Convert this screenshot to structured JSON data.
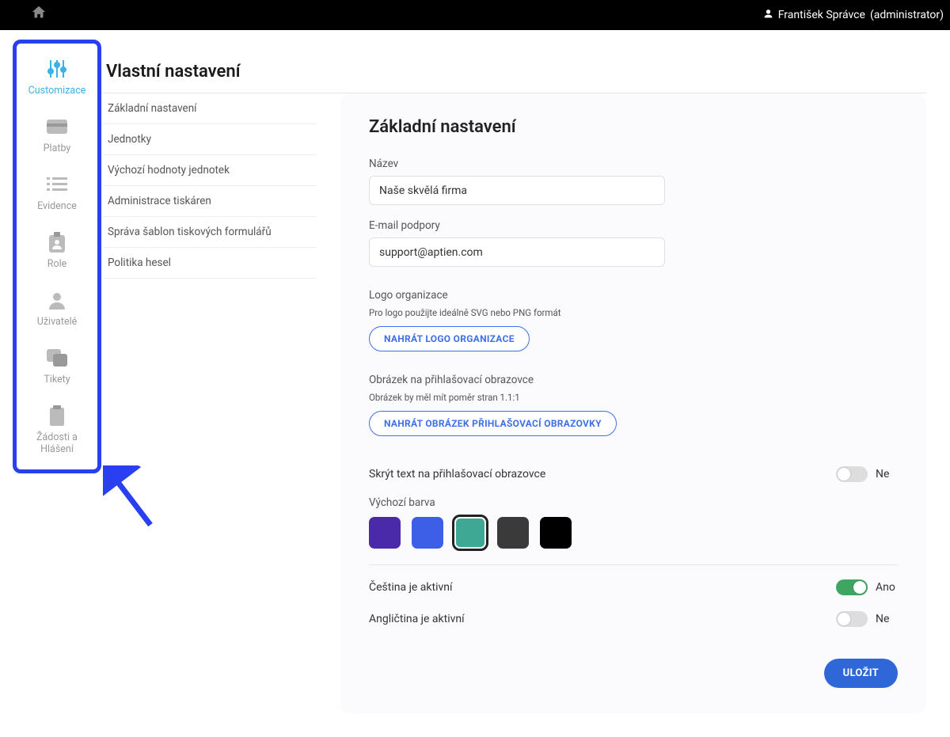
{
  "topbar": {
    "user_name": "František Správce",
    "user_role": "(administrator)"
  },
  "sidebar": {
    "items": [
      {
        "label": "Customizace",
        "icon": "sliders",
        "active": true
      },
      {
        "label": "Platby",
        "icon": "card",
        "active": false
      },
      {
        "label": "Evidence",
        "icon": "list",
        "active": false
      },
      {
        "label": "Role",
        "icon": "badge",
        "active": false
      },
      {
        "label": "Uživatelé",
        "icon": "user",
        "active": false
      },
      {
        "label": "Tikety",
        "icon": "tickets",
        "active": false
      },
      {
        "label": "Žádosti a Hlášení",
        "icon": "clipboard",
        "active": false
      }
    ]
  },
  "page": {
    "title": "Vlastní nastavení",
    "subnav": [
      "Základní nastavení",
      "Jednotky",
      "Výchozí hodnoty jednotek",
      "Administrace tiskáren",
      "Správa šablon tiskových formulářů",
      "Politika hesel"
    ]
  },
  "form": {
    "title": "Základní nastavení",
    "name_label": "Název",
    "name_value": "Naše skvělá firma",
    "email_label": "E-mail podpory",
    "email_value": "support@aptien.com",
    "logo_label": "Logo organizace",
    "logo_hint": "Pro logo použijte ideálně SVG nebo PNG formát",
    "logo_button": "NAHRÁT LOGO ORGANIZACE",
    "loginimg_label": "Obrázek na přihlašovací obrazovce",
    "loginimg_hint": "Obrázek by měl mít poměr stran 1.1:1",
    "loginimg_button": "NAHRÁT OBRÁZEK PŘIHLAŠOVACÍ OBRAZOVKY",
    "hide_text_label": "Skrýt text na přihlašovací obrazovce",
    "hide_text_value": "Ne",
    "color_label": "Výchozí barva",
    "colors": [
      "#4a2aa8",
      "#3d5fe8",
      "#3fa894",
      "#3a3a3a",
      "#000000"
    ],
    "color_selected_index": 2,
    "czech_label": "Čeština je aktivní",
    "czech_value": "Ano",
    "english_label": "Angličtina je aktivní",
    "english_value": "Ne",
    "save_button": "ULOŽIT"
  }
}
